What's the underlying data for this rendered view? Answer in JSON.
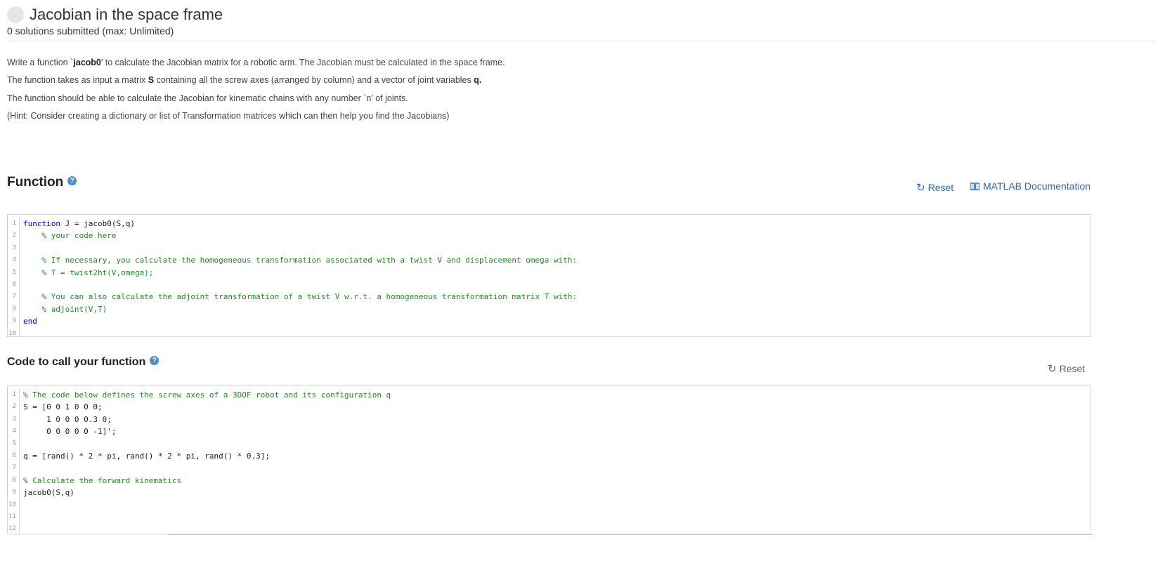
{
  "header": {
    "title": "Jacobian in the space frame",
    "subtitle": "0 solutions submitted (max: Unlimited)"
  },
  "description": {
    "p1_pre": "Write a function `",
    "p1_bold": "jacob0",
    "p1_post": "' to calculate the Jacobian matrix for a robotic arm. The Jacobian must be calculated in the space frame.",
    "p2_pre": "The function takes as input a matrix ",
    "p2_bold1": "S",
    "p2_mid": " containing all the screw axes (arranged by column) and a vector of joint variables ",
    "p2_bold2": "q.",
    "p3": "The function should be able to calculate the Jacobian for kinematic chains with any number `n' of joints.",
    "p4": "(Hint: Consider creating a dictionary or list of Transformation matrices which can then help you find the Jacobians)"
  },
  "function_section": {
    "title": "Function",
    "help_icon": "?",
    "reset_label": "Reset",
    "docs_label": "MATLAB Documentation",
    "lines": [
      {
        "n": "1",
        "tokens": [
          {
            "t": "function",
            "c": "kw"
          },
          {
            "t": " J = jacob0(S,q)",
            "c": ""
          }
        ]
      },
      {
        "n": "2",
        "tokens": [
          {
            "t": "    % your code here",
            "c": "cm"
          }
        ]
      },
      {
        "n": "3",
        "tokens": []
      },
      {
        "n": "4",
        "tokens": [
          {
            "t": "    % If necessary, you calculate the homogeneous transformation associated with a twist V and displacement omega with:",
            "c": "cm"
          }
        ]
      },
      {
        "n": "5",
        "tokens": [
          {
            "t": "    % T = twist2ht(V,omega);",
            "c": "cm"
          }
        ]
      },
      {
        "n": "6",
        "tokens": []
      },
      {
        "n": "7",
        "tokens": [
          {
            "t": "    % You can also calculate the adjoint transformation of a twist V w.r.t. a homogeneous transformation matrix T with:",
            "c": "cm"
          }
        ]
      },
      {
        "n": "8",
        "tokens": [
          {
            "t": "    % adjoint(V,T)",
            "c": "cm"
          }
        ]
      },
      {
        "n": "9",
        "tokens": [
          {
            "t": "end",
            "c": "kw"
          }
        ]
      },
      {
        "n": "10",
        "tokens": []
      }
    ]
  },
  "call_section": {
    "title": "Code to call your function",
    "help_icon": "?",
    "reset_label": "Reset",
    "lines": [
      {
        "n": "1",
        "tokens": [
          {
            "t": "% The code below defines the screw axes of a 3DOF robot and its configuration q",
            "c": "cm"
          }
        ]
      },
      {
        "n": "2",
        "tokens": [
          {
            "t": "S = [0 0 1 0 0 0;",
            "c": ""
          }
        ]
      },
      {
        "n": "3",
        "tokens": [
          {
            "t": "     1 0 0 0 0.3 0;",
            "c": ""
          }
        ]
      },
      {
        "n": "4",
        "tokens": [
          {
            "t": "     0 0 0 0 0 -1]';",
            "c": ""
          }
        ]
      },
      {
        "n": "5",
        "tokens": []
      },
      {
        "n": "6",
        "tokens": [
          {
            "t": "q = [rand() * 2 * pi, rand() * 2 * pi, rand() * 0.3];",
            "c": ""
          }
        ]
      },
      {
        "n": "7",
        "tokens": []
      },
      {
        "n": "8",
        "tokens": [
          {
            "t": "% Calculate the forward kinematics",
            "c": "cm"
          }
        ]
      },
      {
        "n": "9",
        "tokens": [
          {
            "t": "jacob0(S,q)",
            "c": ""
          }
        ]
      },
      {
        "n": "10",
        "tokens": []
      },
      {
        "n": "11",
        "tokens": []
      },
      {
        "n": "12",
        "tokens": []
      }
    ]
  }
}
